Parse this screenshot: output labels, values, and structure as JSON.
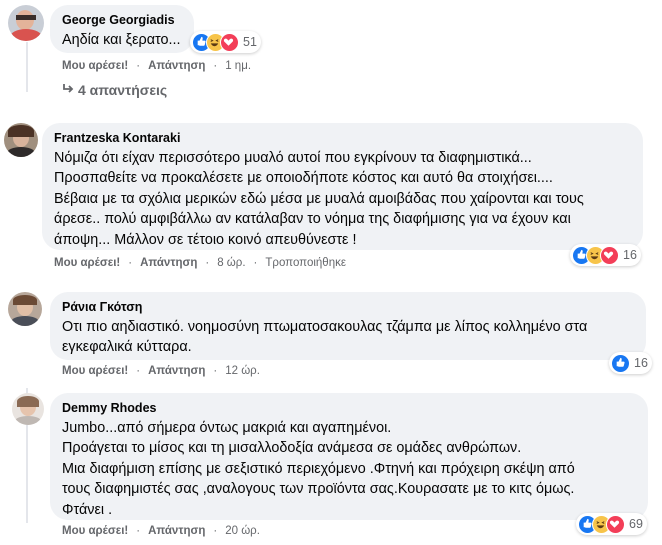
{
  "comments": [
    {
      "author": "George Georgiadis",
      "lines": [
        "Αηδία και ξερατο..."
      ],
      "like_label": "Μου αρέσει!",
      "reply_label": "Απάντηση",
      "time": "1 ημ.",
      "reactions_count": "51",
      "reply_summary": "4 απαντήσεις"
    },
    {
      "author": "Frantzeska Kontaraki",
      "lines": [
        "Νόμιζα ότι είχαν περισσότερο μυαλό αυτοί που εγκρίνουν τα διαφημιστικά...",
        "Προσπαθείτε να προκαλέσετε με οποιοδήποτε κόστος και αυτό θα στοιχήσει....",
        "Βέβαια με τα σχόλια μερικών εδώ μέσα με μυαλά αμοιβάδας που χαίρονται και τους",
        "άρεσε.. πολύ αμφιβάλλω αν κατάλαβαν το νόημα της διαφήμισης για να έχουν και",
        "άποψη... Μάλλον σε τέτοιο κοινό απευθύνεστε !"
      ],
      "like_label": "Μου αρέσει!",
      "reply_label": "Απάντηση",
      "time": "8 ώρ.",
      "edited": "Τροποποιήθηκε",
      "reactions_count": "16"
    },
    {
      "author": "Ράνια Γκότση",
      "lines": [
        "Οτι πιο αηδιαστικό. νοημοσύνη πτωματοσακουλας τζάμπα με λίπος κολλημένο στα",
        "εγκεφαλικά κύτταρα."
      ],
      "like_label": "Μου αρέσει!",
      "reply_label": "Απάντηση",
      "time": "12 ώρ.",
      "reactions_count": "16"
    },
    {
      "author": "Demmy Rhodes",
      "lines": [
        "Jumbo...από σήμερα όντως μακριά και αγαπημένοι.",
        "Προάγεται το μίσος και τη μισαλλοδοξία ανάμεσα σε ομάδες ανθρώπων.",
        "Μια διαφήμιση επίσης με σεξιστικό περιεχόμενο .Φτηνή και πρόχειρη σκέψη από",
        "τους διαφημιστές σας ,αναλογους των προϊόντα σας.Κουρασατε με το κιτς όμως.",
        "Φτάνει ."
      ],
      "like_label": "Μου αρέσει!",
      "reply_label": "Απάντηση",
      "time": "20 ώρ.",
      "reactions_count": "69"
    }
  ],
  "reaction_icons": [
    "like-icon",
    "haha-icon",
    "love-icon"
  ],
  "colors": {
    "bubble": "#f0f2f5",
    "secondary_text": "#65676b",
    "like": "#1877f2",
    "haha": "#f7c44a",
    "love": "#f33e58"
  }
}
